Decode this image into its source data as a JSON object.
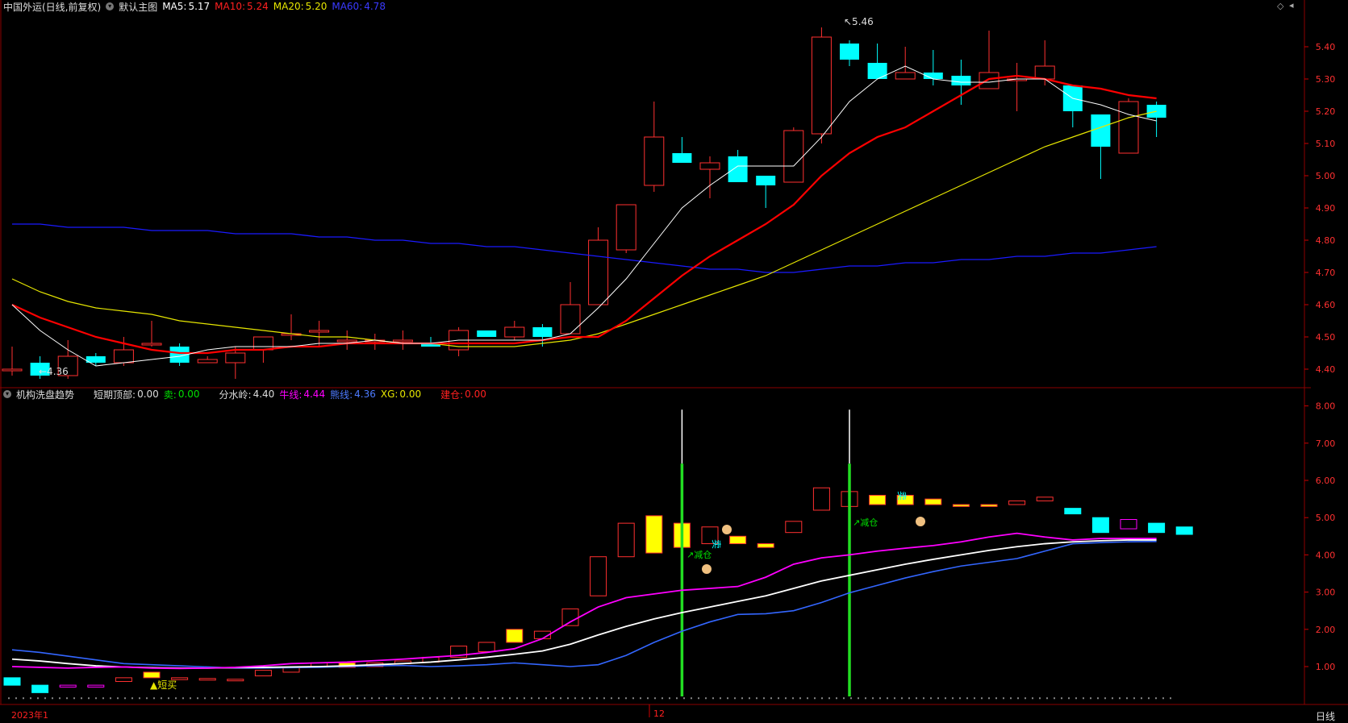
{
  "header": {
    "title": "中国外运(日线,前复权)",
    "template": "默认主图",
    "ma5_label": "MA5:",
    "ma5_value": "5.17",
    "ma10_label": "MA10:",
    "ma10_value": "5.24",
    "ma20_label": "MA20:",
    "ma20_value": "5.20",
    "ma60_label": "MA60:",
    "ma60_value": "4.78"
  },
  "indicator_header": {
    "name": "机构洗盘趋势",
    "top_label": "短期顶部:",
    "top_value": "0.00",
    "sell_label": "卖:",
    "sell_value": "0.00",
    "divide_label": "分水岭:",
    "divide_value": "4.40",
    "bull_label": "牛线:",
    "bull_value": "4.44",
    "bear_label": "熊线:",
    "bear_value": "4.36",
    "xg_label": "XG:",
    "xg_value": "0.00",
    "build_label": "建仓:",
    "build_value": "0.00"
  },
  "price_axis": [
    "5.40",
    "5.30",
    "5.20",
    "5.10",
    "5.00",
    "4.90",
    "4.80",
    "4.70",
    "4.60",
    "4.50",
    "4.40"
  ],
  "ind_axis": [
    "8.00",
    "7.00",
    "6.00",
    "5.00",
    "4.00",
    "3.00",
    "2.00",
    "1.00"
  ],
  "annotations": {
    "high": "5.46",
    "low": "4.36",
    "short_buy": "▲短买",
    "reduce1": "减仓",
    "reduce2": "减仓",
    "sell1": "卖",
    "sell2": "卖"
  },
  "time_axis": {
    "start": "2023年1",
    "mid": "12"
  },
  "period_label": "日线",
  "colors": {
    "up": "#ff3030",
    "down": "#00ffff",
    "ma5": "#ffffff",
    "ma10": "#ff0000",
    "ma20": "#e6e600",
    "ma60": "#1a1aff",
    "bull": "#ff00ff",
    "bear": "#3366ff"
  },
  "chart_data": {
    "type": "candlestick",
    "ylim": [
      4.33,
      5.48
    ],
    "candles": [
      [
        4.4,
        4.4,
        4.47,
        4.38
      ],
      [
        4.42,
        4.38,
        4.44,
        4.37
      ],
      [
        4.38,
        4.44,
        4.49,
        4.37
      ],
      [
        4.44,
        4.42,
        4.45,
        4.41
      ],
      [
        4.42,
        4.46,
        4.5,
        4.41
      ],
      [
        4.48,
        4.48,
        4.55,
        4.47
      ],
      [
        4.47,
        4.42,
        4.48,
        4.41
      ],
      [
        4.42,
        4.43,
        4.44,
        4.42
      ],
      [
        4.42,
        4.45,
        4.47,
        4.37
      ],
      [
        4.46,
        4.5,
        4.5,
        4.42
      ],
      [
        4.51,
        4.51,
        4.57,
        4.49
      ],
      [
        4.52,
        4.52,
        4.55,
        4.47
      ],
      [
        4.49,
        4.49,
        4.52,
        4.46
      ],
      [
        4.49,
        4.49,
        4.51,
        4.46
      ],
      [
        4.49,
        4.49,
        4.52,
        4.46
      ],
      [
        4.48,
        4.47,
        4.5,
        4.47
      ],
      [
        4.46,
        4.52,
        4.53,
        4.44
      ],
      [
        4.52,
        4.5,
        4.52,
        4.5
      ],
      [
        4.5,
        4.53,
        4.55,
        4.49
      ],
      [
        4.53,
        4.5,
        4.54,
        4.47
      ],
      [
        4.51,
        4.6,
        4.67,
        4.51
      ],
      [
        4.6,
        4.8,
        4.84,
        4.6
      ],
      [
        4.77,
        4.91,
        4.91,
        4.76
      ],
      [
        4.97,
        5.12,
        5.23,
        4.95
      ],
      [
        5.07,
        5.04,
        5.12,
        5.04
      ],
      [
        5.02,
        5.04,
        5.06,
        4.93
      ],
      [
        5.06,
        4.98,
        5.08,
        4.98
      ],
      [
        5.0,
        4.97,
        5.0,
        4.9
      ],
      [
        4.98,
        5.14,
        5.15,
        4.98
      ],
      [
        5.13,
        5.43,
        5.46,
        5.1
      ],
      [
        5.41,
        5.36,
        5.42,
        5.34
      ],
      [
        5.35,
        5.3,
        5.41,
        5.3
      ],
      [
        5.3,
        5.32,
        5.4,
        5.3
      ],
      [
        5.32,
        5.3,
        5.39,
        5.28
      ],
      [
        5.31,
        5.28,
        5.36,
        5.22
      ],
      [
        5.27,
        5.32,
        5.45,
        5.27
      ],
      [
        5.3,
        5.3,
        5.35,
        5.2
      ],
      [
        5.3,
        5.34,
        5.42,
        5.28
      ],
      [
        5.28,
        5.2,
        5.28,
        5.15
      ],
      [
        5.19,
        5.09,
        5.19,
        4.99
      ],
      [
        5.07,
        5.23,
        5.24,
        5.07
      ],
      [
        5.22,
        5.18,
        5.23,
        5.12
      ]
    ],
    "ma5": [
      4.6,
      4.52,
      4.46,
      4.41,
      4.42,
      4.43,
      4.44,
      4.46,
      4.47,
      4.47,
      4.47,
      4.48,
      4.48,
      4.49,
      4.48,
      4.48,
      4.49,
      4.49,
      4.49,
      4.49,
      4.51,
      4.59,
      4.68,
      4.79,
      4.9,
      4.97,
      5.03,
      5.03,
      5.03,
      5.12,
      5.23,
      5.3,
      5.34,
      5.3,
      5.29,
      5.29,
      5.3,
      5.3,
      5.24,
      5.22,
      5.19,
      5.17
    ],
    "ma10": [
      4.6,
      4.56,
      4.53,
      4.5,
      4.48,
      4.46,
      4.45,
      4.45,
      4.46,
      4.46,
      4.47,
      4.47,
      4.48,
      4.48,
      4.48,
      4.48,
      4.48,
      4.48,
      4.48,
      4.49,
      4.5,
      4.5,
      4.55,
      4.62,
      4.69,
      4.75,
      4.8,
      4.85,
      4.91,
      5.0,
      5.07,
      5.12,
      5.15,
      5.2,
      5.25,
      5.3,
      5.31,
      5.3,
      5.28,
      5.27,
      5.25,
      5.24
    ],
    "ma20": [
      4.68,
      4.64,
      4.61,
      4.59,
      4.58,
      4.57,
      4.55,
      4.54,
      4.53,
      4.52,
      4.51,
      4.5,
      4.5,
      4.49,
      4.48,
      4.48,
      4.47,
      4.47,
      4.47,
      4.48,
      4.49,
      4.51,
      4.54,
      4.57,
      4.6,
      4.63,
      4.66,
      4.69,
      4.73,
      4.77,
      4.81,
      4.85,
      4.89,
      4.93,
      4.97,
      5.01,
      5.05,
      5.09,
      5.12,
      5.15,
      5.18,
      5.2
    ],
    "ma60": [
      4.85,
      4.85,
      4.84,
      4.84,
      4.84,
      4.83,
      4.83,
      4.83,
      4.82,
      4.82,
      4.82,
      4.81,
      4.81,
      4.8,
      4.8,
      4.79,
      4.79,
      4.78,
      4.78,
      4.77,
      4.76,
      4.75,
      4.74,
      4.73,
      4.72,
      4.71,
      4.71,
      4.7,
      4.7,
      4.71,
      4.72,
      4.72,
      4.73,
      4.73,
      4.74,
      4.74,
      4.75,
      4.75,
      4.76,
      4.76,
      4.77,
      4.78
    ],
    "indicator": {
      "ylim": [
        0.2,
        8.2
      ],
      "bars": [
        [
          0.5,
          0.7
        ],
        [
          0.3,
          0.5
        ],
        [
          0.45,
          0.5
        ],
        [
          0.45,
          0.5
        ],
        [
          0.6,
          0.7
        ],
        [
          0.7,
          0.85
        ],
        [
          0.65,
          0.7
        ],
        [
          0.65,
          0.68
        ],
        [
          0.65,
          0.66
        ],
        [
          0.75,
          0.9
        ],
        [
          0.85,
          0.98
        ],
        [
          0.98,
          1.1
        ],
        [
          0.98,
          1.1
        ],
        [
          1.0,
          1.1
        ],
        [
          1.08,
          1.15
        ],
        [
          1.12,
          1.25
        ],
        [
          1.25,
          1.55
        ],
        [
          1.4,
          1.65
        ],
        [
          1.65,
          2.0
        ],
        [
          1.75,
          1.95
        ],
        [
          2.1,
          2.55
        ],
        [
          2.9,
          3.95
        ],
        [
          3.95,
          4.85
        ],
        [
          4.05,
          5.05
        ],
        [
          4.2,
          4.85
        ],
        [
          4.3,
          4.75
        ],
        [
          4.3,
          4.5
        ],
        [
          4.2,
          4.3
        ],
        [
          4.6,
          4.9
        ],
        [
          5.2,
          5.8
        ],
        [
          5.3,
          5.7
        ],
        [
          5.35,
          5.6
        ],
        [
          5.35,
          5.6
        ],
        [
          5.35,
          5.5
        ],
        [
          5.3,
          5.35
        ],
        [
          5.3,
          5.35
        ],
        [
          5.35,
          5.45
        ],
        [
          5.45,
          5.55
        ],
        [
          5.1,
          5.25
        ],
        [
          4.6,
          5.0
        ],
        [
          4.7,
          4.95
        ],
        [
          4.6,
          4.85
        ],
        [
          4.55,
          4.75
        ]
      ],
      "bull": [
        1.0,
        0.98,
        0.96,
        0.98,
        0.99,
        0.96,
        0.95,
        0.96,
        0.98,
        1.02,
        1.08,
        1.1,
        1.12,
        1.16,
        1.2,
        1.25,
        1.3,
        1.38,
        1.48,
        1.75,
        2.2,
        2.6,
        2.85,
        2.95,
        3.05,
        3.1,
        3.15,
        3.4,
        3.75,
        3.92,
        4.0,
        4.1,
        4.18,
        4.25,
        4.35,
        4.48,
        4.58,
        4.48,
        4.4,
        4.44,
        4.44,
        4.44
      ],
      "white": [
        1.2,
        1.15,
        1.08,
        1.02,
        0.99,
        0.97,
        0.96,
        0.96,
        0.97,
        0.98,
        0.99,
        1.0,
        1.02,
        1.05,
        1.08,
        1.12,
        1.18,
        1.25,
        1.33,
        1.42,
        1.6,
        1.85,
        2.08,
        2.28,
        2.45,
        2.6,
        2.75,
        2.9,
        3.1,
        3.3,
        3.45,
        3.6,
        3.75,
        3.88,
        4.0,
        4.12,
        4.22,
        4.3,
        4.35,
        4.38,
        4.4,
        4.4
      ],
      "bear": [
        1.45,
        1.38,
        1.28,
        1.18,
        1.08,
        1.05,
        1.02,
        0.99,
        0.96,
        0.96,
        0.97,
        0.98,
        1.0,
        1.02,
        1.03,
        1.0,
        1.02,
        1.05,
        1.1,
        1.05,
        1.0,
        1.05,
        1.3,
        1.65,
        1.95,
        2.2,
        2.4,
        2.42,
        2.5,
        2.72,
        2.98,
        3.18,
        3.38,
        3.55,
        3.7,
        3.8,
        3.9,
        4.1,
        4.3,
        4.33,
        4.35,
        4.36
      ],
      "spikes": [
        24,
        30
      ]
    }
  }
}
